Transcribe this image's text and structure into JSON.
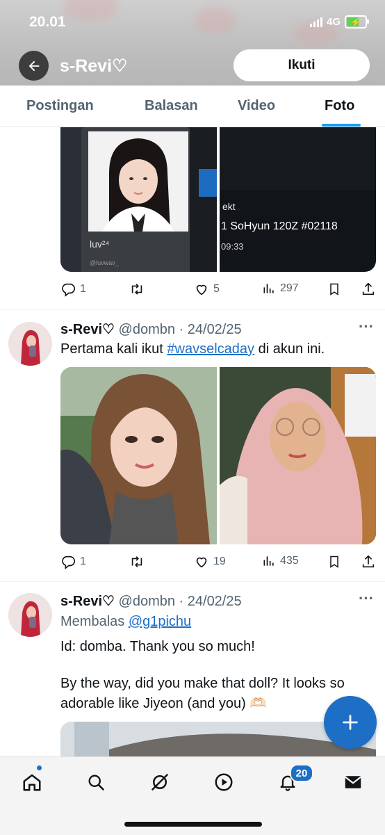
{
  "status_bar": {
    "time": "20.01",
    "network": "4G"
  },
  "header": {
    "title": "s-Revi♡",
    "follow_label": "Ikuti"
  },
  "tabs": [
    {
      "label": "Postingan"
    },
    {
      "label": "Balasan"
    },
    {
      "label": "Video"
    },
    {
      "label": "Foto",
      "active": true
    }
  ],
  "post1": {
    "media_left": {
      "card_name": "luv²⁴",
      "card_handle": "@luvwav_"
    },
    "media_right": {
      "line1": "ekt",
      "line2": "1 SoHyun 120Z #02118",
      "line3": "09:33"
    },
    "stats": {
      "replies": "1",
      "likes": "5",
      "views": "297"
    }
  },
  "post2": {
    "display_name": "s-Revi♡",
    "meta": "@dombn · 24/02/25",
    "text_before": "Pertama kali ikut ",
    "hashtag": "#wavselcaday",
    "text_after": " di akun ini.",
    "stats": {
      "replies": "1",
      "likes": "19",
      "views": "435"
    }
  },
  "post3": {
    "display_name": "s-Revi♡",
    "meta": "@dombn · 24/02/25",
    "replying_prefix": "Membalas ",
    "replying_to": "@g1pichu",
    "line1": "Id: domba. Thank you so much!",
    "line2": "By the way, did you make that doll? It looks so adorable like Jiyeon (and you) 🫶🏻"
  },
  "bottom_nav": {
    "notifications_badge": "20"
  },
  "colors": {
    "accent": "#1d6ec5",
    "muted": "#536471",
    "text": "#0f1419"
  },
  "icons": [
    "back-arrow-icon",
    "signal-icon",
    "battery-icon",
    "reply-icon",
    "retweet-icon",
    "like-icon",
    "views-icon",
    "bookmark-icon",
    "share-icon",
    "more-icon",
    "plus-icon",
    "home-icon",
    "search-icon",
    "grok-icon",
    "play-icon",
    "bell-icon",
    "mail-icon"
  ]
}
